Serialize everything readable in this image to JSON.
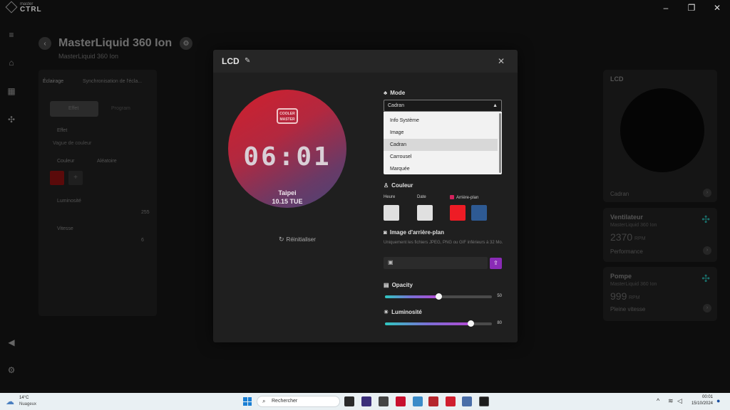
{
  "app": {
    "brand_small": "master",
    "brand_big": "CTRL",
    "page_title": "MasterLiquid 360 Ion",
    "page_subtitle": "MasterLiquid 360 Ion"
  },
  "left_panel": {
    "lighting_label": "Éclairage",
    "sync_label": "Synchronisation de l'écla...",
    "tab_effect": "Effet",
    "tab_program": "Program",
    "effect_label": "Effet",
    "effect_value": "Vague de couleur",
    "color_label": "Couleur",
    "random_label": "Aléatoire",
    "brightness_label": "Luminosité",
    "brightness_value": "255",
    "speed_label": "Vitesse",
    "speed_value": "6"
  },
  "right_cards": {
    "lcd": {
      "title": "LCD",
      "footer": "Cadran"
    },
    "fan": {
      "title": "Ventilateur",
      "subtitle": "MasterLiquid 360 Ion",
      "value": "2370",
      "unit": "RPM",
      "footer": "Performance"
    },
    "pump": {
      "title": "Pompe",
      "subtitle": "MasterLiquid 360 Ion",
      "value": "999",
      "unit": "RPM",
      "footer": "Pleine vitesse"
    }
  },
  "modal": {
    "title": "LCD",
    "preview": {
      "logo_line1": "COOLER",
      "logo_line2": "MASTER",
      "time": "06:01",
      "city": "Taipei",
      "date": "10.15 TUE"
    },
    "reset_label": "Réinitialiser",
    "mode": {
      "label": "Mode",
      "selected": "Cadran",
      "options": [
        "Info Système",
        "Image",
        "Cadran",
        "Carrousel",
        "Marquée"
      ],
      "selected_index": 2
    },
    "color": {
      "label": "Couleur",
      "hour_label": "Heure",
      "date_label": "Date",
      "background_label": "Arrière-plan",
      "hour_color": "#e0e0e0",
      "date_color": "#e0e0e0",
      "background_colors": [
        "#ee1c25",
        "#2e5a93"
      ]
    },
    "bg_image": {
      "label": "Image d'arrière-plan",
      "note": "Uniquement les fichiers JPEG, PNG ou GIF inférieurs à 32 Mo."
    },
    "opacity": {
      "label": "Opacity",
      "value": "50",
      "percent": 50
    },
    "brightness": {
      "label": "Luminosité",
      "value": "80",
      "percent": 80
    }
  },
  "taskbar": {
    "temp": "14°C",
    "condition": "Nuageux",
    "search_placeholder": "Rechercher",
    "time": "00:01",
    "date": "15/10/2024"
  }
}
